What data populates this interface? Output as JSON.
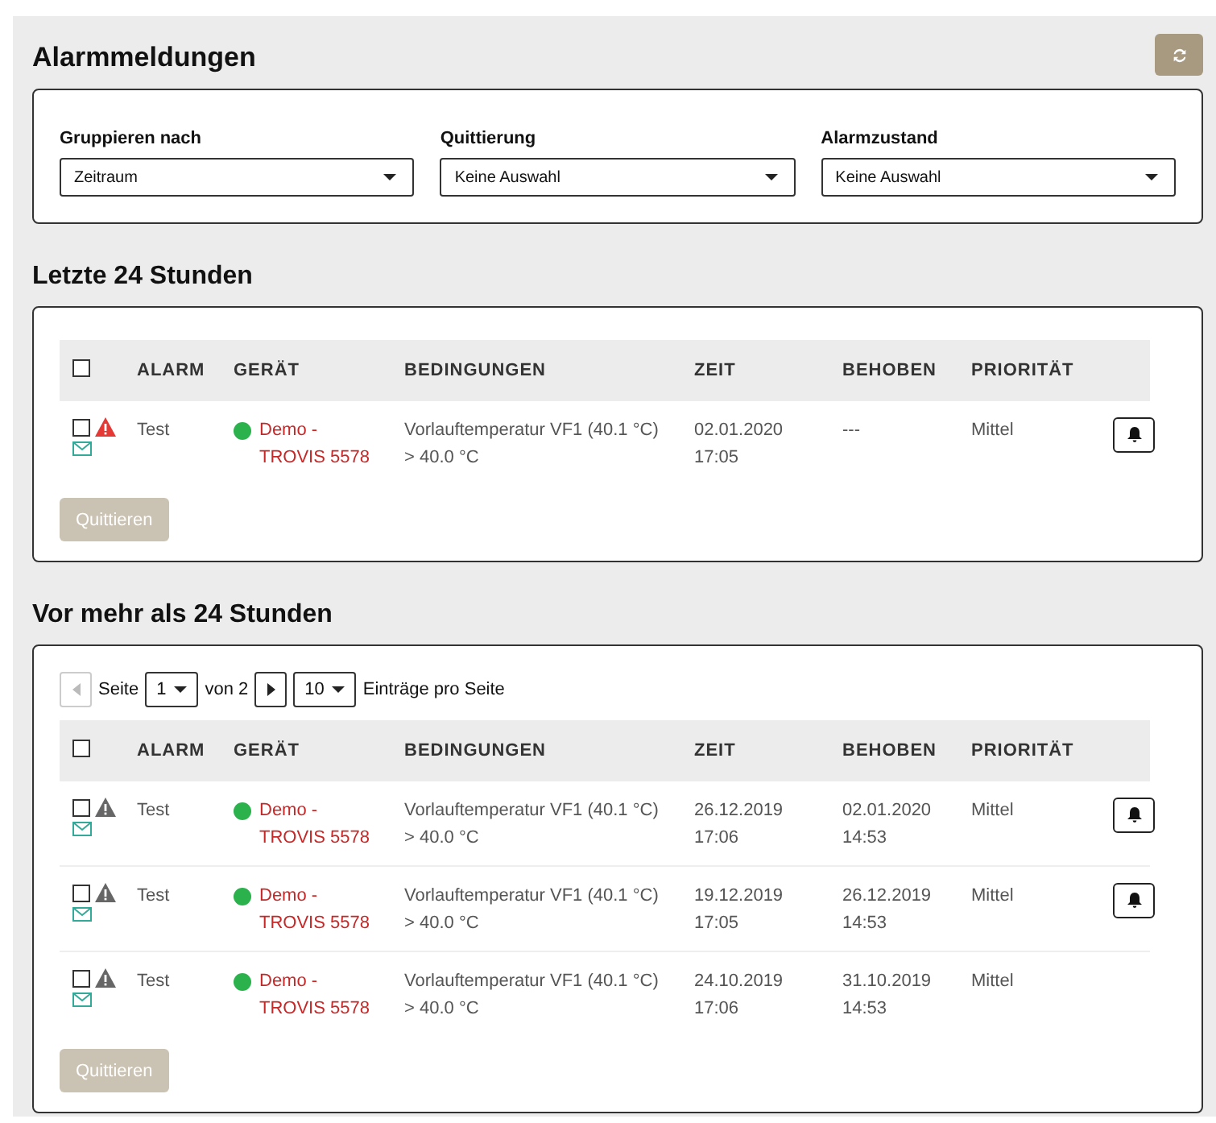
{
  "title": "Alarmmeldungen",
  "filters": [
    {
      "label": "Gruppieren nach",
      "value": "Zeitraum"
    },
    {
      "label": "Quittierung",
      "value": "Keine Auswahl"
    },
    {
      "label": "Alarmzustand",
      "value": "Keine Auswahl"
    }
  ],
  "sections": [
    {
      "heading": "Letzte 24 Stunden",
      "all_checked": false,
      "columns": [
        "ALARM",
        "GERÄT",
        "BEDINGUNGEN",
        "ZEIT",
        "BEHOBEN",
        "PRIORITÄT"
      ],
      "rows": [
        {
          "checked": false,
          "active": true,
          "alarm": "Test",
          "device": "Demo - TROVIS 5578",
          "color": "#2bb24c",
          "condition": "Vorlauftemperatur VF1 (40.1 °C) > 40.0 °C",
          "time": "02.01.2020 17:05",
          "resolved": "---",
          "priority": "Mittel",
          "bell": true
        }
      ],
      "action": {
        "label": "Quittieren",
        "disabled": true
      }
    },
    {
      "heading": "Vor mehr als 24 Stunden",
      "all_checked": false,
      "pager": {
        "page_label": "Seite",
        "page": "1",
        "of": "von 2",
        "per_page": "10",
        "per_page_label": "Einträge pro Seite",
        "prev_disabled": true,
        "next_disabled": false
      },
      "columns": [
        "ALARM",
        "GERÄT",
        "BEDINGUNGEN",
        "ZEIT",
        "BEHOBEN",
        "PRIORITÄT"
      ],
      "rows": [
        {
          "checked": false,
          "active": false,
          "alarm": "Test",
          "device": "Demo - TROVIS 5578",
          "color": "#2bb24c",
          "condition": "Vorlauftemperatur VF1 (40.1 °C) > 40.0 °C",
          "time": "26.12.2019 17:06",
          "resolved": "02.01.2020 14:53",
          "priority": "Mittel",
          "bell": true
        },
        {
          "checked": false,
          "active": false,
          "alarm": "Test",
          "device": "Demo - TROVIS 5578",
          "color": "#2bb24c",
          "condition": "Vorlauftemperatur VF1 (40.1 °C) > 40.0 °C",
          "time": "19.12.2019 17:05",
          "resolved": "26.12.2019 14:53",
          "priority": "Mittel",
          "bell": true
        },
        {
          "checked": false,
          "active": false,
          "alarm": "Test",
          "device": "Demo - TROVIS 5578",
          "color": "#2bb24c",
          "condition": "Vorlauftemperatur VF1 (40.1 °C) > 40.0 °C",
          "time": "24.10.2019 17:06",
          "resolved": "31.10.2019 14:53",
          "priority": "Mittel",
          "bell": false
        }
      ],
      "action": {
        "label": "Quittieren",
        "disabled": true
      }
    }
  ]
}
